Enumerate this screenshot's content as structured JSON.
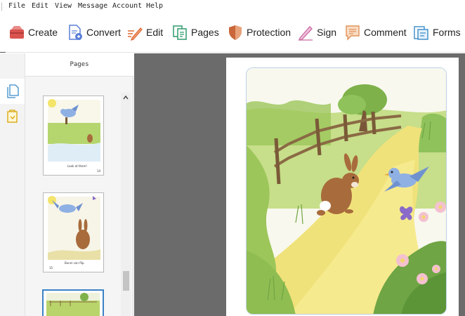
{
  "menubar": {
    "items": [
      "File",
      "Edit",
      "View",
      "Message",
      "Account",
      "Help"
    ]
  },
  "toolbar": {
    "create": "Create",
    "convert": "Convert",
    "edit": "Edit",
    "pages": "Pages",
    "protection": "Protection",
    "sign": "Sign",
    "comment": "Comment",
    "forms": "Forms"
  },
  "sidebar": {
    "title": "Pages",
    "icons": [
      "pages-panel-icon",
      "attachments-icon"
    ]
  },
  "thumbnails": [
    {
      "caption": "Look at them!",
      "page_number": "14"
    },
    {
      "caption": "Bunni can flip.",
      "page_number": "15"
    },
    {
      "caption": "",
      "page_number": ""
    }
  ],
  "colors": {
    "create": "#d9534f",
    "convert": "#5b7fd6",
    "edit": "#e0672e",
    "pages": "#2f9b6c",
    "protection": "#c9663a",
    "sign": "#c96aa2",
    "comment": "#e0935a",
    "forms": "#3a8bc9",
    "viewer_background": "#6b6b6b",
    "selection": "#3b82c6"
  }
}
